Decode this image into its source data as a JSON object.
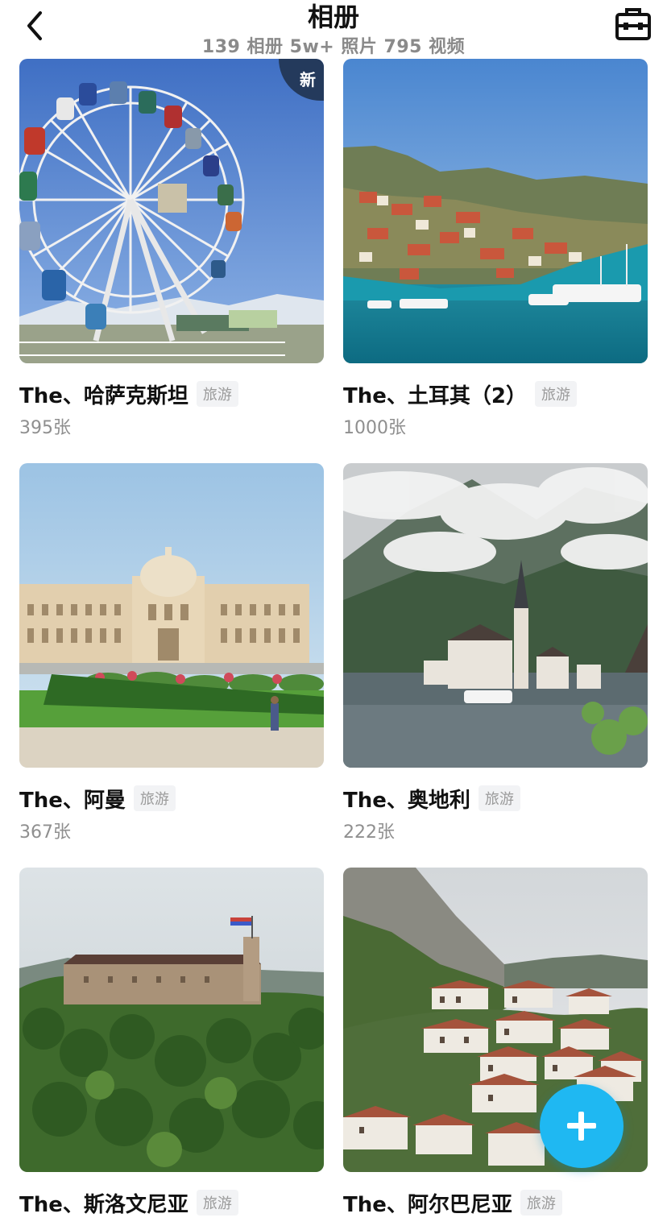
{
  "header": {
    "title": "相册",
    "subtitle": "139 相册 5w+ 照片 795 视频",
    "back_icon": "chevron-left-icon",
    "toolbox_icon": "toolbox-icon"
  },
  "albums": [
    {
      "name": "The、哈萨克斯坦",
      "tag": "旅游",
      "count": "395张",
      "badge": "新"
    },
    {
      "name": "The、土耳其（2）",
      "tag": "旅游",
      "count": "1000张"
    },
    {
      "name": "The、阿曼",
      "tag": "旅游",
      "count": "367张"
    },
    {
      "name": "The、奥地利",
      "tag": "旅游",
      "count": "222张"
    },
    {
      "name": "The、斯洛文尼亚",
      "tag": "旅游",
      "count": ""
    },
    {
      "name": "The、阿尔巴尼亚",
      "tag": "旅游",
      "count": ""
    }
  ],
  "fab": {
    "icon": "plus-icon"
  },
  "colors": {
    "accent": "#1fb8f2",
    "badge": "#243a5c",
    "tag_bg": "#f2f3f5"
  }
}
